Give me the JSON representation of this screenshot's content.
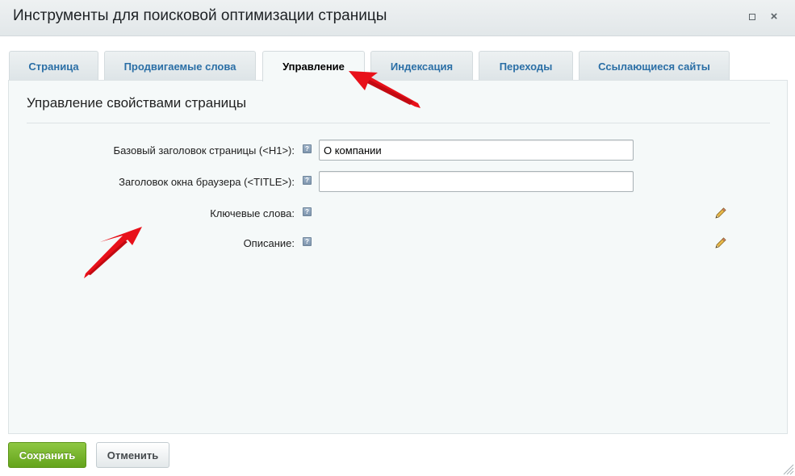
{
  "window": {
    "title": "Инструменты для поисковой оптимизации страницы",
    "maximize_icon": "maximize-icon",
    "close_icon": "close-icon",
    "close_glyph": "×"
  },
  "tabs": [
    {
      "label": "Страница",
      "active": false
    },
    {
      "label": "Продвигаемые слова",
      "active": false
    },
    {
      "label": "Управление",
      "active": true
    },
    {
      "label": "Индексация",
      "active": false
    },
    {
      "label": "Переходы",
      "active": false
    },
    {
      "label": "Ссылающиеся сайты",
      "active": false
    }
  ],
  "section": {
    "title": "Управление свойствами страницы"
  },
  "fields": {
    "h1": {
      "label": "Базовый заголовок страницы (<H1>):",
      "value": "О компании",
      "help": "?"
    },
    "title": {
      "label": "Заголовок окна браузера (<TITLE>):",
      "value": "",
      "help": "?"
    },
    "keywords": {
      "label": "Ключевые слова:",
      "help": "?",
      "edit_icon": "pencil-icon"
    },
    "description": {
      "label": "Описание:",
      "help": "?",
      "edit_icon": "pencil-icon"
    }
  },
  "buttons": {
    "save": "Сохранить",
    "cancel": "Отменить"
  },
  "colors": {
    "accent_tab_text": "#2b6fa6",
    "save_green": "#6fae22",
    "annotation_red": "#e8111a"
  }
}
